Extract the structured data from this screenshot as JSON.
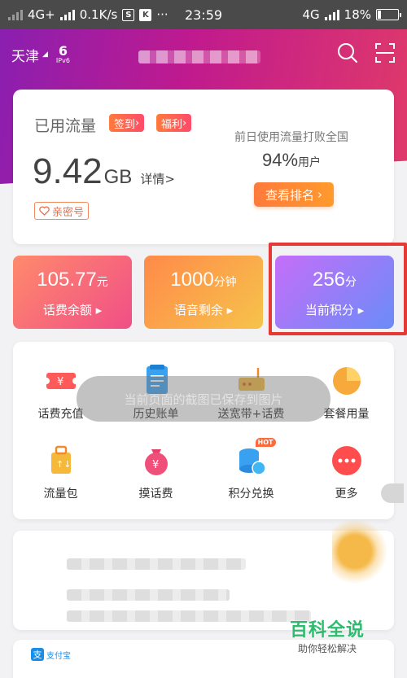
{
  "status_bar": {
    "network": "4G+",
    "speed": "0.1K/s",
    "time": "23:59",
    "network_right": "4G",
    "battery": "18%",
    "battery_level": 0.18,
    "sim_icon": "S",
    "app_icon": "K",
    "more": "···"
  },
  "header": {
    "city": "天津",
    "ipv6_label": "IPv6",
    "ipv6_mark": "6"
  },
  "usage": {
    "title": "已用流量",
    "sign_in": "签到",
    "welfare": "福利",
    "value": "9.42",
    "unit": "GB",
    "detail": "详情>",
    "couple_tag": "亲密号",
    "rank_caption": "前日使用流量打败全国",
    "rank_percent": "94%",
    "rank_suffix": "用户",
    "rank_button": "查看排名"
  },
  "stats": [
    {
      "value": "105.77",
      "unit": "元",
      "label": "话费余额"
    },
    {
      "value": "1000",
      "unit": "分钟",
      "label": "语音剩余"
    },
    {
      "value": "256",
      "unit": "分",
      "label": "当前积分"
    }
  ],
  "services": {
    "row1": [
      "话费充值",
      "历史账单",
      "送宽带+话费",
      "套餐用量"
    ],
    "row2": [
      "流量包",
      "摸话费",
      "积分兑换",
      "更多"
    ],
    "hot_badge": "HOT",
    "toast": "当前页面的截图已保存到图片"
  },
  "promo": {
    "brand": "支付宝"
  },
  "watermark": {
    "title": "百科全说",
    "subtitle": "助你轻松解决"
  },
  "colors": {
    "header_start": "#8a1fb0",
    "header_end": "#e03a6a",
    "highlight": "#e53935",
    "accent_orange": "#ff7a3c"
  }
}
